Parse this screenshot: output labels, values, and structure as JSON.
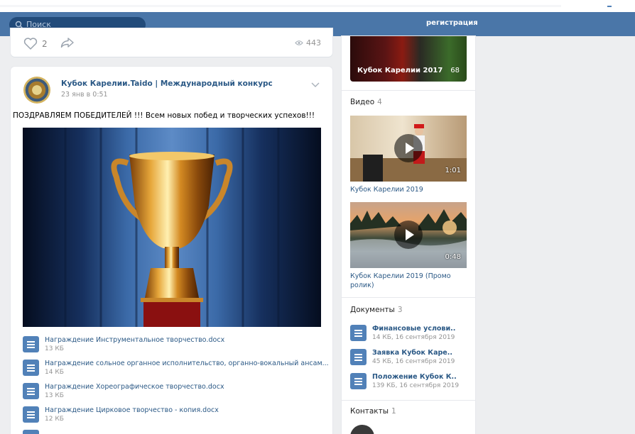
{
  "header": {
    "search_placeholder": "Поиск",
    "register": "регистрация"
  },
  "prev_post": {
    "likes": "2",
    "views": "443"
  },
  "post": {
    "author": "Кубок Карелии.Taido | Международный конкурс",
    "date": "23 янв в 0:51",
    "text": "ПОЗДРАВЛЯЕМ ПОБЕДИТЕЛЕЙ !!! Всем новых побед и творческих успехов!!!",
    "attachments": [
      {
        "name": "Награждение Инструментальное творчество.docx",
        "size": "13 КБ"
      },
      {
        "name": "Награждение сольное органное исполнительство, органно-вокальный ансам...",
        "size": "14 КБ"
      },
      {
        "name": "Награждение Хореографическое творчество.docx",
        "size": "13 КБ"
      },
      {
        "name": "Награждение Цирковое творчество - копия.docx",
        "size": "12 КБ"
      }
    ]
  },
  "sidebar": {
    "album": {
      "title": "Кубок Карелии 2017",
      "count": "68"
    },
    "videos": {
      "title": "Видео",
      "count": "4",
      "items": [
        {
          "title": "Кубок Карелии 2019",
          "duration": "1:01"
        },
        {
          "title": "Кубок Карелии 2019 (Промо ролик)",
          "duration": "0:48"
        }
      ]
    },
    "documents": {
      "title": "Документы",
      "count": "3",
      "items": [
        {
          "name": "Финансовые услови..",
          "meta": "14 КБ, 16 сентября 2019"
        },
        {
          "name": "Заявка Кубок Каре..",
          "meta": "45 КБ, 16 сентября 2019"
        },
        {
          "name": "Положение Кубок К..",
          "meta": "139 КБ, 16 сентября 2019"
        }
      ]
    },
    "contacts": {
      "title": "Контакты",
      "count": "1"
    }
  }
}
